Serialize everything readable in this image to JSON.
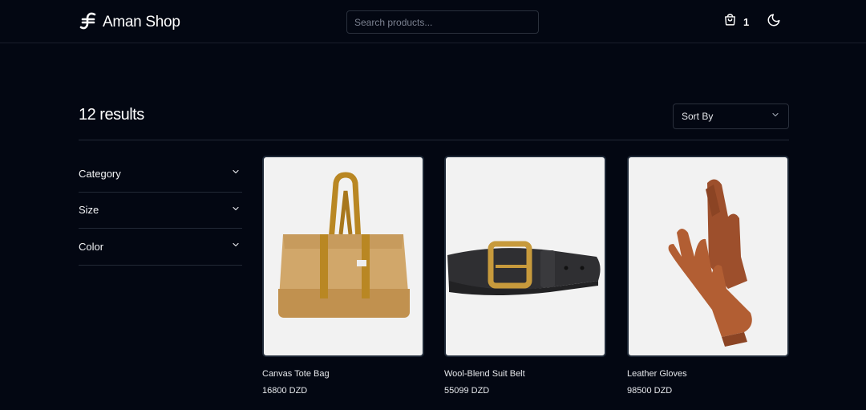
{
  "header": {
    "brand": "Aman Shop",
    "search_placeholder": "Search products...",
    "cart_count": "1",
    "brand_icon": "logo-icon",
    "cart_icon": "shopping-bag-icon",
    "theme_icon": "moon-icon"
  },
  "results": {
    "title": "12 results",
    "sort_label": "Sort By"
  },
  "filters": [
    {
      "label": "Category"
    },
    {
      "label": "Size"
    },
    {
      "label": "Color"
    }
  ],
  "products": [
    {
      "name": "Canvas Tote Bag",
      "price": "16800 DZD",
      "image": "tote-bag-image"
    },
    {
      "name": "Wool-Blend Suit Belt",
      "price": "55099 DZD",
      "image": "belt-image"
    },
    {
      "name": "Leather Gloves",
      "price": "98500 DZD",
      "image": "gloves-image"
    }
  ],
  "colors": {
    "background": "#030712",
    "border": "#232936",
    "text": "#f3f4f6",
    "image_bg": "#f2f2f2"
  }
}
